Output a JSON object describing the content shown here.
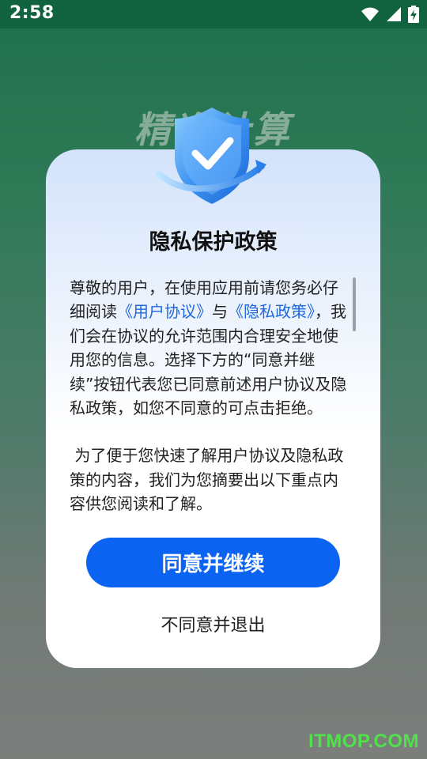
{
  "status_bar": {
    "time": "2:58",
    "icons": [
      "wifi-icon",
      "signal-icon",
      "battery-charging-icon"
    ]
  },
  "background": {
    "title": "精准计算"
  },
  "dialog": {
    "icon": "shield-check-icon",
    "title": "隐私保护政策",
    "paragraph1": {
      "prefix": "尊敬的用户，在使用应用前请您务必仔细阅读",
      "link1": "《用户协议》",
      "middle": "与",
      "link2": "《隐私政策》",
      "suffix": "，我们会在协议的允许范围内合理安全地使用您的信息。选择下方的“同意并继续”按钮代表您已同意前述用户协议及隐私政策，如您不同意的可点击拒绝。"
    },
    "paragraph2": " 为了便于您快速了解用户协议及隐私政策的内容，我们为您摘要出以下重点内容供您阅读和了解。",
    "agree_label": "同意并继续",
    "decline_label": "不同意并退出"
  },
  "watermark": "ITMOP.COM",
  "colors": {
    "accent": "#0a63f1",
    "link": "#1f68e0",
    "status_bar": "#11633f"
  }
}
